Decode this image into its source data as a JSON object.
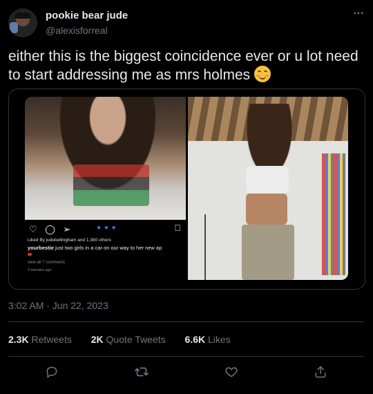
{
  "author": {
    "display_name": "pookie bear jude",
    "handle": "@alexisforreal"
  },
  "tweet": {
    "text": "either this is the biggest coincidence ever or u lot need to start addressing me as mrs holmes",
    "emoji": "smiling-face-with-smiling-eyes",
    "timestamp": "3:02 AM · Jun 22, 2023"
  },
  "instagram_embed": {
    "liked_by": "Liked By judebellingham and 1,380 others",
    "caption_user": "yourbestie",
    "caption_text": " just two girls in a car on our way to her new ap",
    "comments": "view all 7 comments",
    "time": "3 minutes ago"
  },
  "stats": {
    "retweets_count": "2.3K",
    "retweets_label": "Retweets",
    "quotes_count": "2K",
    "quotes_label": "Quote Tweets",
    "likes_count": "6.6K",
    "likes_label": "Likes"
  },
  "colors": {
    "background": "#000000",
    "text_primary": "#e7e9ea",
    "text_secondary": "#71767b",
    "border": "#2f3336"
  },
  "icons": [
    "more-icon",
    "reply-icon",
    "retweet-icon",
    "like-icon",
    "share-icon"
  ]
}
